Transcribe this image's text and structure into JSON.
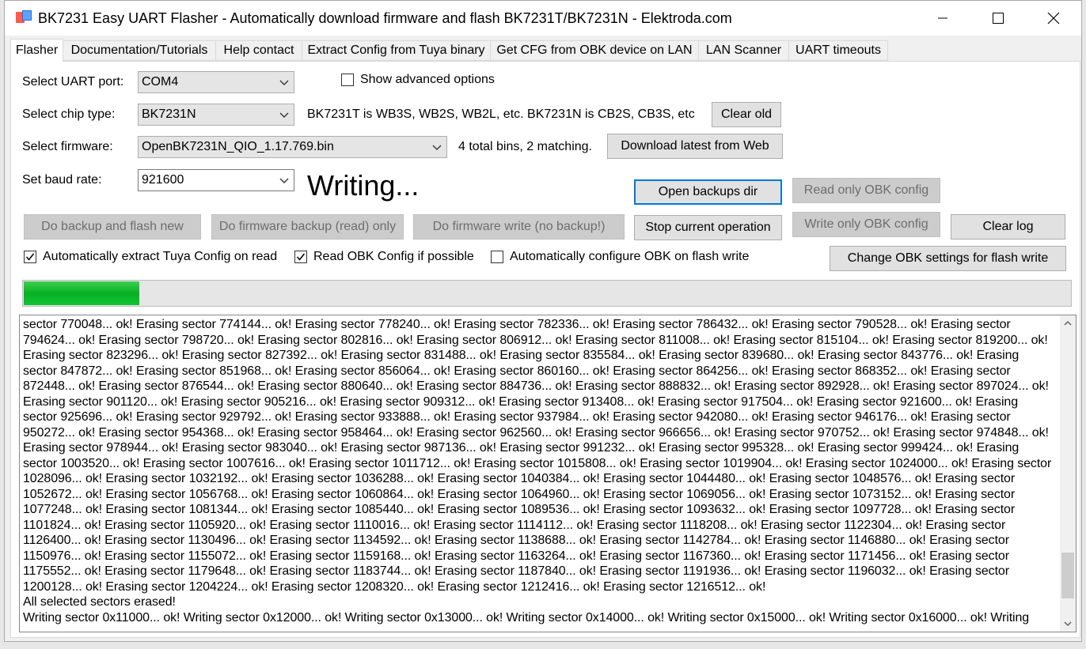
{
  "window": {
    "title": "BK7231 Easy UART Flasher - Automatically download firmware and flash BK7231T/BK7231N  - Elektroda.com"
  },
  "tabs": [
    {
      "label": "Flasher"
    },
    {
      "label": "Documentation/Tutorials"
    },
    {
      "label": "Help contact"
    },
    {
      "label": "Extract Config from Tuya binary"
    },
    {
      "label": "Get CFG from OBK device on LAN"
    },
    {
      "label": "LAN Scanner"
    },
    {
      "label": "UART timeouts"
    }
  ],
  "form": {
    "uart_label": "Select UART port:",
    "uart_value": "COM4",
    "advanced_label": "Show advanced options",
    "chip_label": "Select chip type:",
    "chip_value": "BK7231N",
    "chip_hint": "BK7231T is WB3S, WB2S, WB2L, etc. BK7231N is CB2S, CB3S, etc",
    "clear_old": "Clear old",
    "firmware_label": "Select firmware:",
    "firmware_value": "OpenBK7231N_QIO_1.17.769.bin",
    "firmware_hint": "4 total bins, 2 matching.",
    "download_latest": "Download latest from Web",
    "baud_label": "Set baud rate:",
    "baud_value": "921600",
    "status": "Writing..."
  },
  "buttons": {
    "open_backups": "Open backups dir",
    "read_obk": "Read only OBK config",
    "backup_flash": "Do backup and flash new",
    "backup_read": "Do firmware backup (read) only",
    "write_nobackup": "Do firmware write (no backup!)",
    "stop": "Stop current operation",
    "write_obk": "Write only OBK config",
    "clear_log": "Clear log",
    "change_obk": "Change OBK settings for flash write"
  },
  "checkboxes": {
    "auto_extract": {
      "label": "Automatically extract Tuya Config on read",
      "checked": true
    },
    "read_obk": {
      "label": "Read OBK Config if possible",
      "checked": true
    },
    "auto_configure": {
      "label": "Automatically configure OBK on flash write",
      "checked": false
    }
  },
  "progress": {
    "fraction": 0.11
  },
  "log": {
    "lines": [
      "sector 770048... ok! Erasing sector 774144... ok! Erasing sector 778240... ok! Erasing sector 782336... ok! Erasing sector 786432... ok! Erasing sector 790528... ok! Erasing sector 794624... ok! Erasing sector 798720... ok! Erasing sector 802816... ok! Erasing sector 806912... ok! Erasing sector 811008... ok! Erasing sector 815104... ok! Erasing sector 819200... ok! Erasing sector 823296... ok! Erasing sector 827392... ok! Erasing sector 831488... ok! Erasing sector 835584... ok! Erasing sector 839680... ok! Erasing sector 843776... ok! Erasing sector 847872... ok! Erasing sector 851968... ok! Erasing sector 856064... ok! Erasing sector 860160... ok! Erasing sector 864256... ok! Erasing sector 868352... ok! Erasing sector 872448... ok! Erasing sector 876544... ok! Erasing sector 880640... ok! Erasing sector 884736... ok! Erasing sector 888832... ok! Erasing sector 892928... ok! Erasing sector 897024... ok! Erasing sector 901120... ok! Erasing sector 905216... ok! Erasing sector 909312... ok! Erasing sector 913408... ok! Erasing sector 917504... ok! Erasing sector 921600... ok! Erasing sector 925696... ok! Erasing sector 929792... ok! Erasing sector 933888... ok! Erasing sector 937984... ok! Erasing sector 942080... ok! Erasing sector 946176... ok! Erasing sector 950272... ok! Erasing sector 954368... ok! Erasing sector 958464... ok! Erasing sector 962560... ok! Erasing sector 966656... ok! Erasing sector 970752... ok! Erasing sector 974848... ok! Erasing sector 978944... ok! Erasing sector 983040... ok! Erasing sector 987136... ok! Erasing sector 991232... ok! Erasing sector 995328... ok! Erasing sector 999424... ok! Erasing sector 1003520... ok! Erasing sector 1007616... ok! Erasing sector 1011712... ok! Erasing sector 1015808... ok! Erasing sector 1019904... ok! Erasing sector 1024000... ok! Erasing sector 1028096... ok! Erasing sector 1032192... ok! Erasing sector 1036288... ok! Erasing sector 1040384... ok! Erasing sector 1044480... ok! Erasing sector 1048576... ok! Erasing sector 1052672... ok! Erasing sector 1056768... ok! Erasing sector 1060864... ok! Erasing sector 1064960... ok! Erasing sector 1069056... ok! Erasing sector 1073152... ok! Erasing sector 1077248... ok! Erasing sector 1081344... ok! Erasing sector 1085440... ok! Erasing sector 1089536... ok! Erasing sector 1093632... ok! Erasing sector 1097728... ok! Erasing sector 1101824... ok! Erasing sector 1105920... ok! Erasing sector 1110016... ok! Erasing sector 1114112... ok! Erasing sector 1118208... ok! Erasing sector 1122304... ok! Erasing sector 1126400... ok! Erasing sector 1130496... ok! Erasing sector 1134592... ok! Erasing sector 1138688... ok! Erasing sector 1142784... ok! Erasing sector 1146880... ok! Erasing sector 1150976... ok! Erasing sector 1155072... ok! Erasing sector 1159168... ok! Erasing sector 1163264... ok! Erasing sector 1167360... ok! Erasing sector 1171456... ok! Erasing sector 1175552... ok! Erasing sector 1179648... ok! Erasing sector 1183744... ok! Erasing sector 1187840... ok! Erasing sector 1191936... ok! Erasing sector 1196032... ok! Erasing sector 1200128... ok! Erasing sector 1204224... ok! Erasing sector 1208320... ok! Erasing sector 1212416... ok! Erasing sector 1216512... ok!",
      "All selected sectors erased!",
      "Writing sector 0x11000... ok! Writing sector 0x12000... ok! Writing sector 0x13000... ok! Writing sector 0x14000... ok! Writing sector 0x15000... ok! Writing sector 0x16000... ok! Writing"
    ]
  },
  "colors": {
    "progress_fill": "#06b025",
    "focus_border": "#0078d7",
    "window_bg": "#f0f0f0"
  }
}
